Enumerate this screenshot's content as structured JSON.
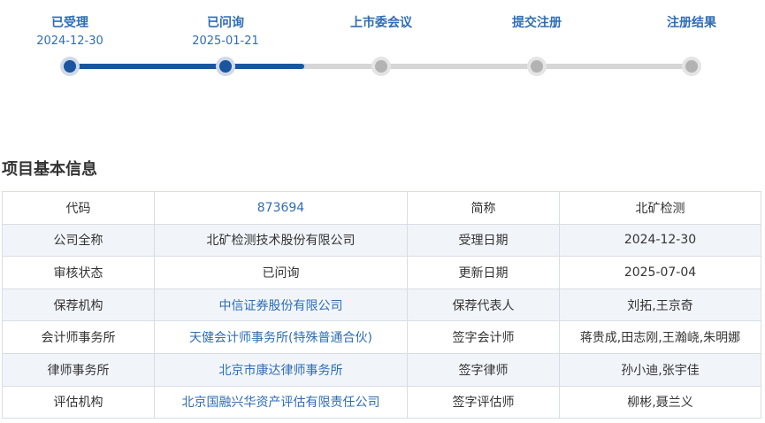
{
  "progress": {
    "steps": [
      {
        "title": "已受理",
        "date": "2024-12-30",
        "state": "done"
      },
      {
        "title": "已问询",
        "date": "2025-01-21",
        "state": "done"
      },
      {
        "title": "上市委会议",
        "date": "",
        "state": "pending"
      },
      {
        "title": "提交注册",
        "date": "",
        "state": "pending"
      },
      {
        "title": "注册结果",
        "date": "",
        "state": "pending"
      }
    ],
    "colors": {
      "done": "#1a56a0",
      "pending": "#b3b3b3",
      "title_text": "#2e6db5"
    }
  },
  "section": {
    "title": "项目基本信息"
  },
  "table": {
    "rows": [
      {
        "label1": "代码",
        "value1": "873694",
        "label2": "简称",
        "value2": "北矿检测"
      },
      {
        "label1": "公司全称",
        "value1": "北矿检测技术股份有限公司",
        "label2": "受理日期",
        "value2": "2024-12-30"
      },
      {
        "label1": "审核状态",
        "value1": "已问询",
        "label2": "更新日期",
        "value2": "2025-07-04"
      },
      {
        "label1": "保荐机构",
        "value1": "中信证券股份有限公司",
        "label2": "保荐代表人",
        "value2": "刘拓,王京奇"
      },
      {
        "label1": "会计师事务所",
        "value1": "天健会计师事务所(特殊普通合伙)",
        "label2": "签字会计师",
        "value2": "蒋贵成,田志刚,王瀚峣,朱明娜"
      },
      {
        "label1": "律师事务所",
        "value1": "北京市康达律师事务所",
        "label2": "签字律师",
        "value2": "孙小迪,张宇佳"
      },
      {
        "label1": "评估机构",
        "value1": "北京国融兴华资产评估有限责任公司",
        "label2": "签字评估师",
        "value2": "柳彬,聂兰义"
      }
    ],
    "colors": {
      "link": "#2e6db5",
      "stripe": "#f1f5fa",
      "border": "#d9dde3"
    }
  }
}
